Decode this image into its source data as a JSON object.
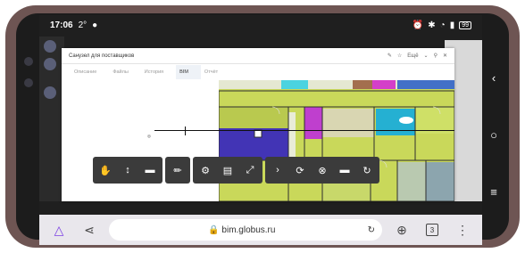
{
  "status_bar": {
    "time": "17:06",
    "temperature": "2°",
    "battery": "99"
  },
  "modal": {
    "title": "Санузел для поставщиков",
    "header_tools": {
      "action": "Ещё"
    },
    "tabs": [
      {
        "label": "Описание",
        "active": false
      },
      {
        "label": "Файлы",
        "active": false
      },
      {
        "label": "История",
        "active": false
      },
      {
        "label": "BIM",
        "active": true
      },
      {
        "label": "Отчёт",
        "active": false
      }
    ]
  },
  "browser": {
    "url": "bim.globus.ru",
    "tab_count": "3"
  },
  "colors": {
    "plan_green": "#bfd44a",
    "plan_purple": "#4236a8",
    "plan_magenta": "#b845c9",
    "plan_cyan": "#2ab3d4",
    "plan_grey": "#8fa3b0",
    "toolbar_bg": "#3b3b3b",
    "browser_accent": "#7b3fe4"
  },
  "toolbar": {
    "groups": [
      [
        "hand-icon",
        "move-vertical-icon",
        "camera-icon"
      ],
      [
        "pencil-icon"
      ],
      [
        "gear-icon",
        "layers-icon",
        "fullscreen-icon"
      ],
      [
        "chevron-right-icon",
        "rotate-icon",
        "close-circle-icon",
        "minus-square-icon",
        "refresh-icon"
      ]
    ]
  }
}
